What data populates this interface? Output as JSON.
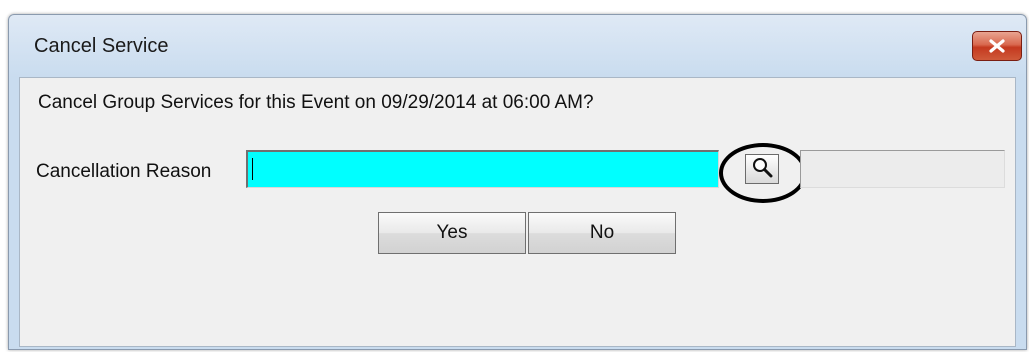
{
  "dialog": {
    "title": "Cancel Service",
    "close_icon": "close-x-icon",
    "close_color": "#c4391f"
  },
  "prompt": {
    "text": "Cancel Group Services for this Event on 09/29/2014 at 06:00 AM?"
  },
  "reason": {
    "label": "Cancellation Reason",
    "value": "",
    "field_color": "#00ffff",
    "lookup_icon": "magnifier-icon",
    "description_value": ""
  },
  "buttons": {
    "yes_label": "Yes",
    "no_label": "No"
  }
}
